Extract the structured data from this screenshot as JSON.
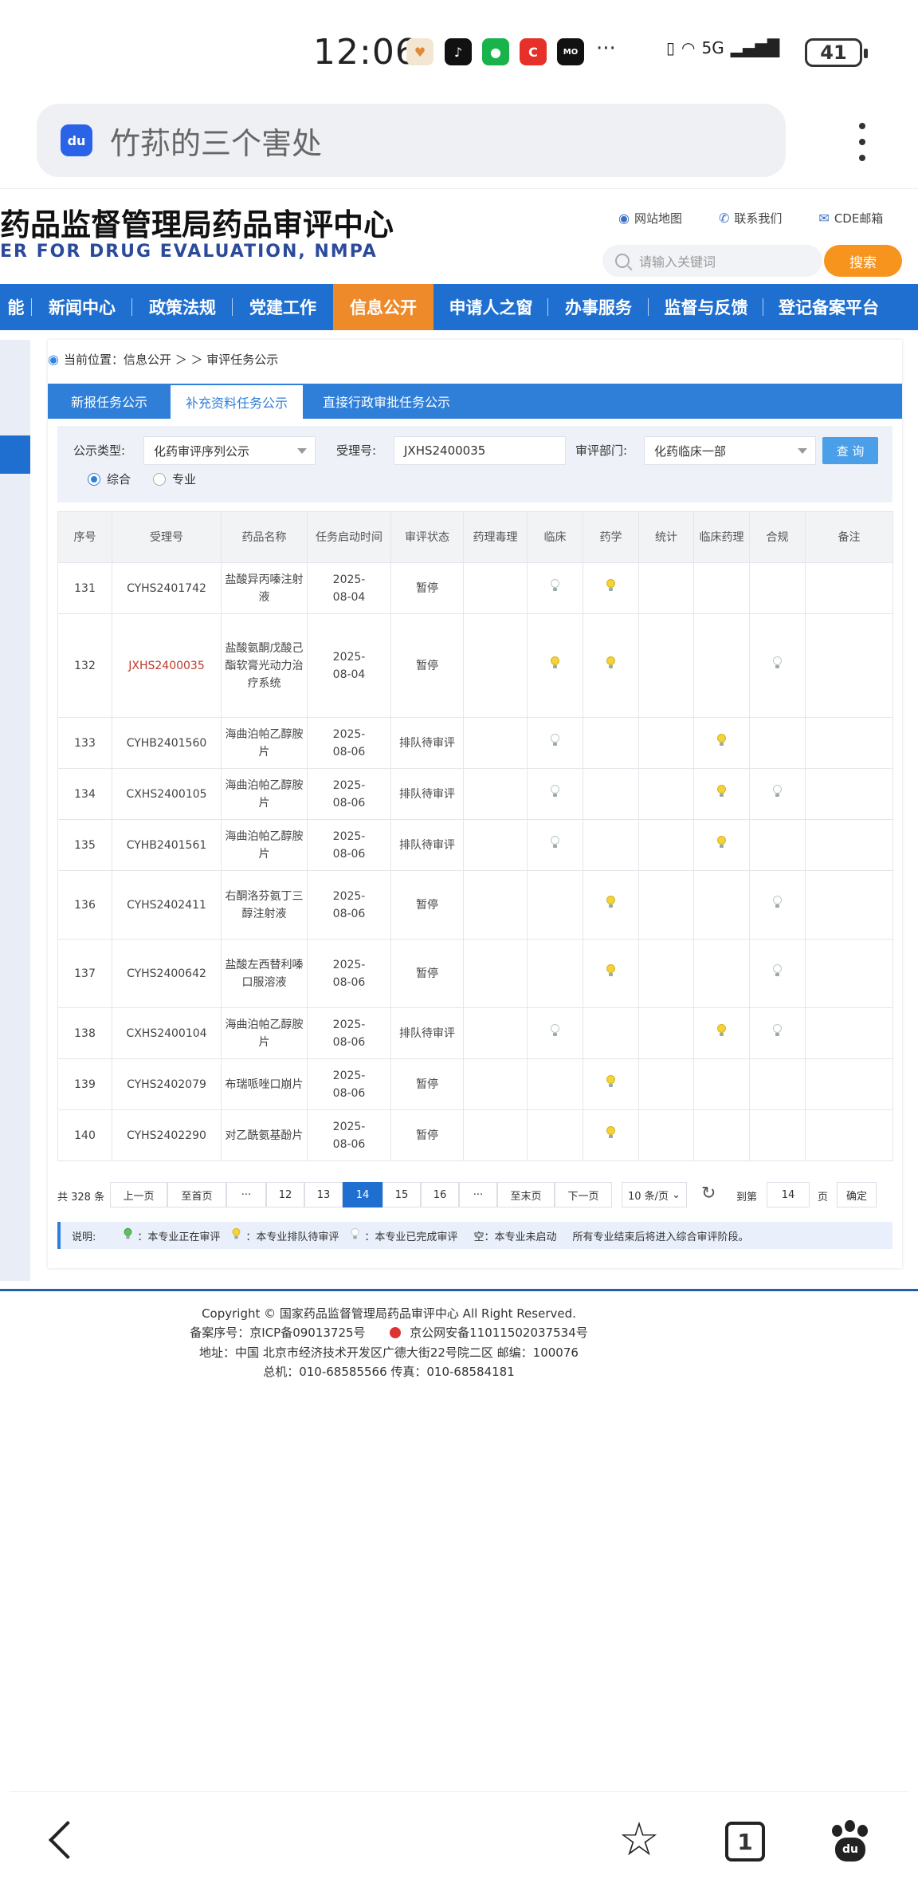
{
  "status_bar": {
    "time": "12:06",
    "more": "···",
    "network": "5G",
    "battery": "41"
  },
  "browser": {
    "search_query": "竹荪的三个害处",
    "logo_text": "du"
  },
  "site": {
    "title": "药品监督管理局药品审评中心",
    "subtitle": "ER FOR DRUG EVALUATION, NMPA",
    "top_links": [
      "网站地图",
      "联系我们",
      "CDE邮箱"
    ],
    "search_placeholder": "请输入关键词",
    "search_button": "搜索"
  },
  "nav": {
    "items": [
      "能",
      "新闻中心",
      "政策法规",
      "党建工作",
      "信息公开",
      "申请人之窗",
      "办事服务",
      "监督与反馈",
      "登记备案平台"
    ],
    "active": "信息公开"
  },
  "breadcrumb": {
    "label": "当前位置：信息公开 ＞ ＞ 审评任务公示"
  },
  "tabs": [
    "新报任务公示",
    "补充资料任务公示",
    "直接行政审批任务公示"
  ],
  "active_tab": "补充资料任务公示",
  "filter": {
    "type_label": "公示类型:",
    "type_value": "化药审评序列公示",
    "accept_label": "受理号:",
    "accept_value": "JXHS2400035",
    "dept_label": "审评部门:",
    "dept_value": "化药临床一部",
    "query_button": "查 询",
    "radio_1": "综合",
    "radio_2": "专业",
    "radio_selected": "综合"
  },
  "table": {
    "headers": [
      "序号",
      "受理号",
      "药品名称",
      "任务启动时间",
      "审评状态",
      "药理毒理",
      "临床",
      "药学",
      "统计",
      "临床药理",
      "合规",
      "备注"
    ],
    "rows": [
      {
        "no": "131",
        "id": "CYHS2401742",
        "name": "盐酸异丙嗪注射液",
        "date": "2025-08-04",
        "status": "暂停",
        "lamps": [
          "",
          "w",
          "y",
          "",
          "",
          "",
          ""
        ]
      },
      {
        "no": "132",
        "id": "JXHS2400035",
        "name": "盐酸氨酮戊酸己酯软膏光动力治疗系统",
        "date": "2025-08-04",
        "status": "暂停",
        "lamps": [
          "",
          "y",
          "y",
          "",
          "",
          "w",
          ""
        ]
      },
      {
        "no": "133",
        "id": "CYHB2401560",
        "name": "海曲泊帕乙醇胺片",
        "date": "2025-08-06",
        "status": "排队待审评",
        "lamps": [
          "",
          "w",
          "",
          "",
          "y",
          "",
          ""
        ]
      },
      {
        "no": "134",
        "id": "CXHS2400105",
        "name": "海曲泊帕乙醇胺片",
        "date": "2025-08-06",
        "status": "排队待审评",
        "lamps": [
          "",
          "w",
          "",
          "",
          "y",
          "w",
          ""
        ]
      },
      {
        "no": "135",
        "id": "CYHB2401561",
        "name": "海曲泊帕乙醇胺片",
        "date": "2025-08-06",
        "status": "排队待审评",
        "lamps": [
          "",
          "w",
          "",
          "",
          "y",
          "",
          ""
        ]
      },
      {
        "no": "136",
        "id": "CYHS2402411",
        "name": "右酮洛芬氨丁三醇注射液",
        "date": "2025-08-06",
        "status": "暂停",
        "lamps": [
          "",
          "",
          "y",
          "",
          "",
          "w",
          ""
        ]
      },
      {
        "no": "137",
        "id": "CYHS2400642",
        "name": "盐酸左西替利嗪口服溶液",
        "date": "2025-08-06",
        "status": "暂停",
        "lamps": [
          "",
          "",
          "y",
          "",
          "",
          "w",
          ""
        ]
      },
      {
        "no": "138",
        "id": "CXHS2400104",
        "name": "海曲泊帕乙醇胺片",
        "date": "2025-08-06",
        "status": "排队待审评",
        "lamps": [
          "",
          "w",
          "",
          "",
          "y",
          "w",
          ""
        ]
      },
      {
        "no": "139",
        "id": "CYHS2402079",
        "name": "布瑞哌唑口崩片",
        "date": "2025-08-06",
        "status": "暂停",
        "lamps": [
          "",
          "",
          "y",
          "",
          "",
          "",
          ""
        ]
      },
      {
        "no": "140",
        "id": "CYHS2402290",
        "name": "对乙酰氨基酚片",
        "date": "2025-08-06",
        "status": "暂停",
        "lamps": [
          "",
          "",
          "y",
          "",
          "",
          "",
          ""
        ]
      }
    ]
  },
  "pager": {
    "total": "共 328 条",
    "prev": "上一页",
    "first": "至首页",
    "ellipsis": "···",
    "pages": [
      "12",
      "13",
      "14",
      "15",
      "16"
    ],
    "current": "14",
    "last": "至末页",
    "next": "下一页",
    "per_page": "10 条/页",
    "goto_label": "到第",
    "goto_value": "14",
    "page_suffix": "页",
    "confirm": "确定"
  },
  "legend": {
    "label": "说明:",
    "in_review": "：本专业正在审评",
    "queued": "：本专业排队待审评",
    "done": "：本专业已完成审评",
    "empty": "空：本专业未启动",
    "note": "所有专业结束后将进入综合审评阶段。"
  },
  "footer": {
    "copyright": "Copyright © 国家药品监督管理局药品审评中心   All Right Reserved.",
    "icp": "备案序号：京ICP备09013725号",
    "police": "京公网安备11011502037534号",
    "address": "地址：中国 北京市经济技术开发区广德大街22号院二区      邮编：100076",
    "phone": "总机：010-68585566      传真：010-68584181"
  },
  "bottom_bar": {
    "tabs_count": "1"
  }
}
